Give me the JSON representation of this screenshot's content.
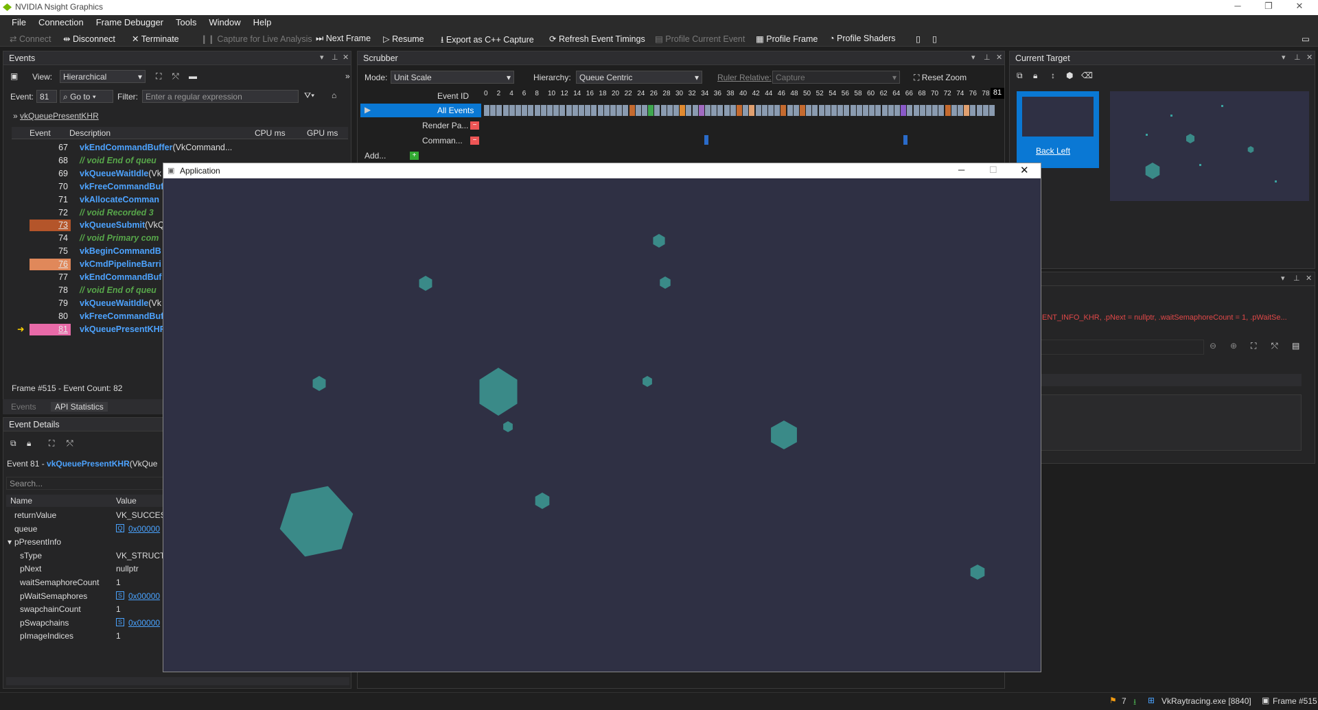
{
  "app_title": "NVIDIA Nsight Graphics",
  "menu": [
    "File",
    "Connection",
    "Frame Debugger",
    "Tools",
    "Window",
    "Help"
  ],
  "toolbar": {
    "connect": "Connect",
    "disconnect": "Disconnect",
    "terminate": "Terminate",
    "capture_live": "Capture for Live Analysis",
    "next_frame": "Next Frame",
    "resume": "Resume",
    "export": "Export as C++ Capture",
    "refresh": "Refresh Event Timings",
    "profile_current": "Profile Current Event",
    "profile_frame": "Profile Frame",
    "profile_shaders": "Profile Shaders"
  },
  "events_panel": {
    "title": "Events",
    "view_label": "View:",
    "view_value": "Hierarchical",
    "event_label": "Event:",
    "event_value": "81",
    "goto": "Go to",
    "filter_label": "Filter:",
    "filter_placeholder": "Enter a regular expression",
    "breadcrumb": "vkQueuePresentKHR",
    "columns": [
      "Event",
      "Description",
      "CPU ms",
      "GPU ms"
    ],
    "rows": [
      {
        "num": "67",
        "desc": "vkEndCommandBuffer",
        "args": "(VkCommand...",
        "cpu": "-",
        "gpu": "-",
        "type": "call"
      },
      {
        "num": "68",
        "desc": "// void End of queu",
        "args": "",
        "type": "comment"
      },
      {
        "num": "69",
        "desc": "vkQueueWaitIdle",
        "args": "(Vk",
        "type": "call"
      },
      {
        "num": "70",
        "desc": "vkFreeCommandBuf",
        "args": "",
        "type": "call"
      },
      {
        "num": "71",
        "desc": "vkAllocateComman",
        "args": "",
        "type": "call"
      },
      {
        "num": "72",
        "desc": "// void Recorded 3",
        "args": "",
        "type": "comment"
      },
      {
        "num": "73",
        "desc": "vkQueueSubmit",
        "args": "(VkQ",
        "type": "call",
        "hl": "#b4552a"
      },
      {
        "num": "74",
        "desc": "// void Primary com",
        "args": "",
        "type": "comment"
      },
      {
        "num": "75",
        "desc": "vkBeginCommandB",
        "args": "",
        "type": "call"
      },
      {
        "num": "76",
        "desc": "vkCmdPipelineBarri",
        "args": "",
        "type": "call",
        "hl": "#e0885a"
      },
      {
        "num": "77",
        "desc": "vkEndCommandBuf",
        "args": "",
        "type": "call"
      },
      {
        "num": "78",
        "desc": "// void End of queu",
        "args": "",
        "type": "comment"
      },
      {
        "num": "79",
        "desc": "vkQueueWaitIdle",
        "args": "(Vk",
        "type": "call"
      },
      {
        "num": "80",
        "desc": "vkFreeCommandBuf",
        "args": "",
        "type": "call"
      },
      {
        "num": "81",
        "desc": "vkQueuePresentKHR",
        "args": "",
        "type": "call",
        "hl": "#e86aa8"
      }
    ],
    "frame_info": "Frame #515 - Event Count: 82",
    "tabs": [
      "Events",
      "API Statistics"
    ]
  },
  "event_details": {
    "title": "Event Details",
    "event_line_prefix": "Event 81 -",
    "event_fn": "vkQueuePresentKHR",
    "event_args": "(VkQue",
    "search_placeholder": "Search...",
    "columns": [
      "Name",
      "Value"
    ],
    "rows": [
      {
        "name": "returnValue",
        "value": "VK_SUCCESS",
        "indent": 0
      },
      {
        "name": "queue",
        "value": "0x00000",
        "indent": 0,
        "link": true,
        "icon": "Q"
      },
      {
        "name": "pPresentInfo",
        "value": "",
        "indent": 0,
        "expander": "▾"
      },
      {
        "name": "sType",
        "value": "VK_STRUCTU",
        "indent": 1
      },
      {
        "name": "pNext",
        "value": "nullptr",
        "indent": 1
      },
      {
        "name": "waitSemaphoreCount",
        "value": "1",
        "indent": 1
      },
      {
        "name": "pWaitSemaphores",
        "value": "0x00000",
        "indent": 1,
        "link": true,
        "icon": "S"
      },
      {
        "name": "swapchainCount",
        "value": "1",
        "indent": 1
      },
      {
        "name": "pSwapchains",
        "value": "0x00000",
        "indent": 1,
        "link": true,
        "icon": "S"
      },
      {
        "name": "pImageIndices",
        "value": "1",
        "indent": 1
      }
    ]
  },
  "scrubber": {
    "title": "Scrubber",
    "mode_label": "Mode:",
    "mode_value": "Unit Scale",
    "hierarchy_label": "Hierarchy:",
    "hierarchy_value": "Queue Centric",
    "ruler_label": "Ruler Relative:",
    "ruler_value": "Capture",
    "reset_zoom": "Reset Zoom",
    "event_id_label": "Event ID",
    "ticks": [
      "0",
      "2",
      "4",
      "6",
      "8",
      "10",
      "12",
      "14",
      "16",
      "18",
      "20",
      "22",
      "24",
      "26",
      "28",
      "30",
      "32",
      "34",
      "36",
      "38",
      "40",
      "42",
      "44",
      "46",
      "48",
      "50",
      "52",
      "54",
      "56",
      "58",
      "60",
      "62",
      "64",
      "66",
      "68",
      "70",
      "72",
      "74",
      "76",
      "78"
    ],
    "current": "81",
    "rows": [
      "All Events",
      "Render Pa...",
      "Comman...",
      "Add..."
    ]
  },
  "current_target": {
    "title": "Current Target",
    "thumb_label": "Back Left"
  },
  "api_inspector": {
    "line": "ENT_INFO_KHR, .pNext = nullptr, .waitSemaphoreCount = 1, .pWaitSe..."
  },
  "app_window": {
    "title": "Application"
  },
  "status": {
    "count": "7",
    "process": "VkRaytracing.exe [8840]",
    "frame": "Frame #515"
  },
  "colors": {
    "accent": "#0a78d4",
    "comment": "#57a64a",
    "call": "#4da3ff",
    "app_bg": "#2f3044",
    "hex": "#3a8a88"
  }
}
